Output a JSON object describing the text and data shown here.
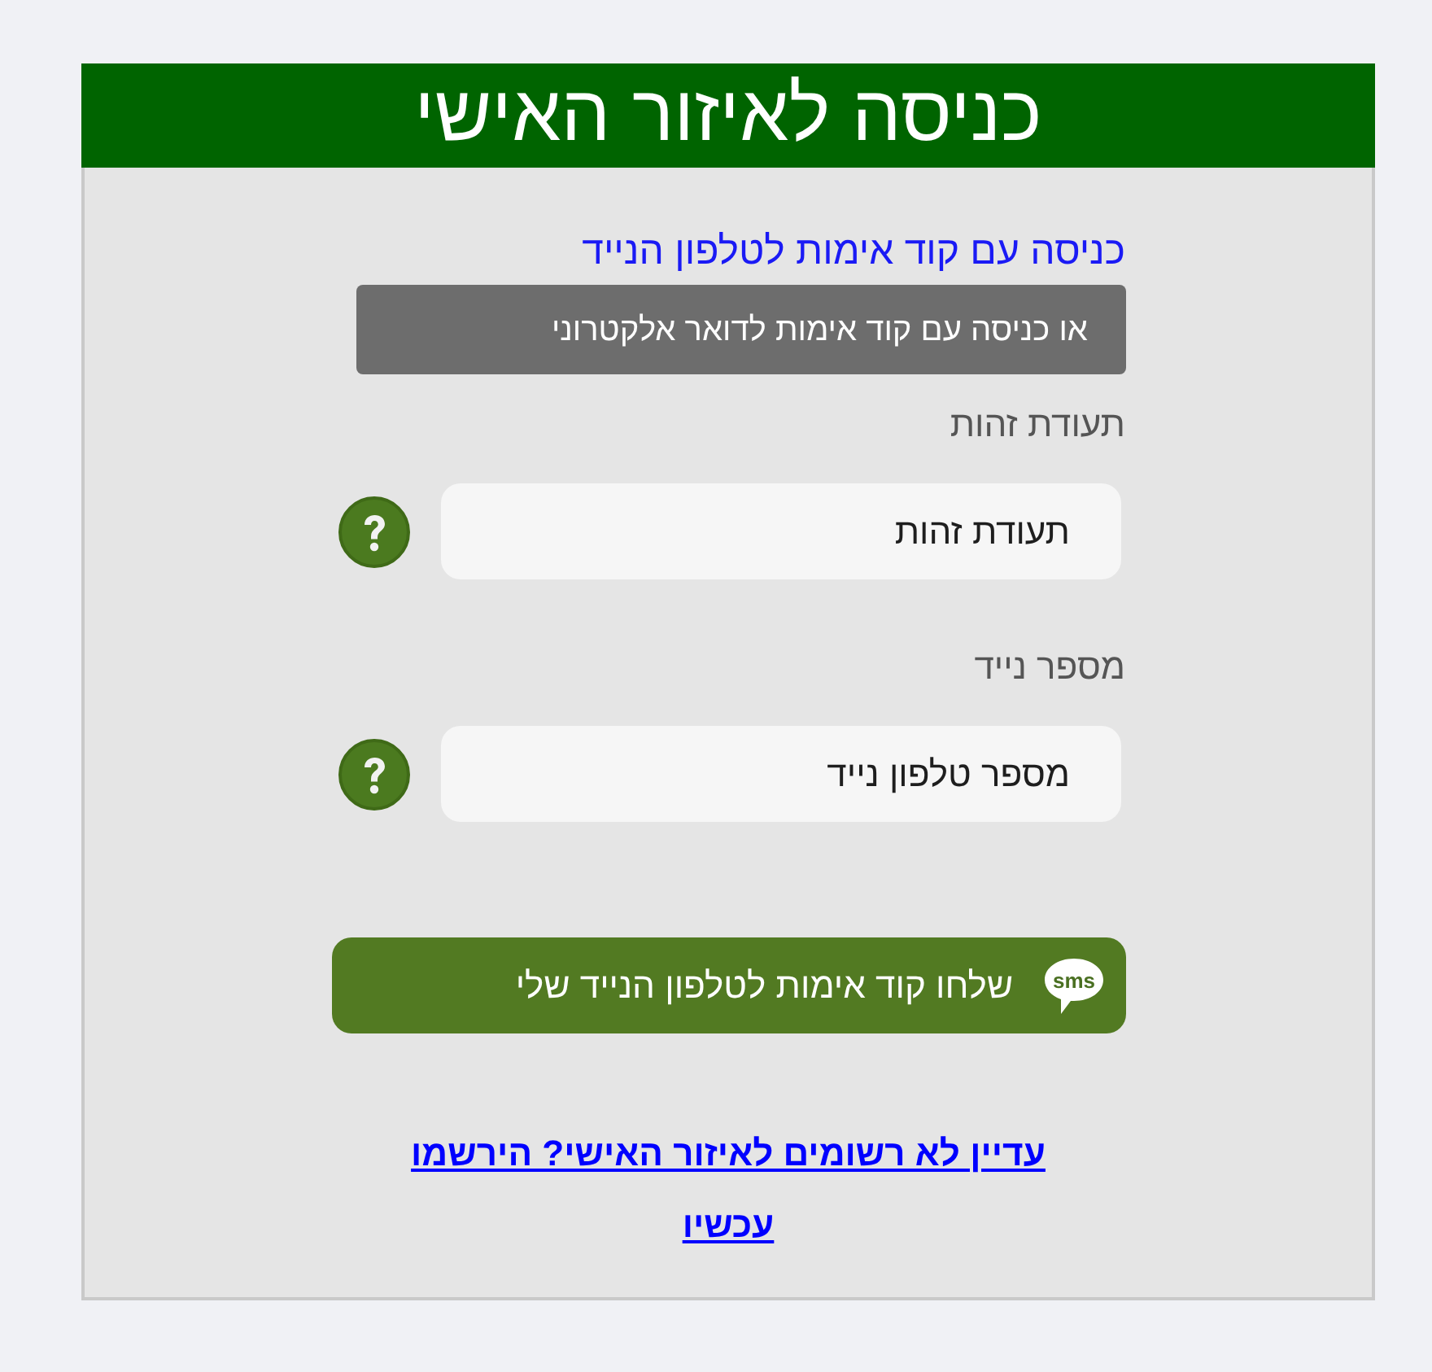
{
  "header": {
    "title": "כניסה לאיזור האישי"
  },
  "login_method": "כניסה עם קוד אימות לטלפון הנייד",
  "switch_method_button": "או כניסה עם קוד אימות לדואר אלקטרוני",
  "fields": [
    {
      "label": "תעודת זהות",
      "placeholder": "תעודת זהות"
    },
    {
      "label": "מספר נייד",
      "placeholder": "מספר טלפון נייד"
    }
  ],
  "send_button": {
    "icon_text": "sms",
    "label": "שלחו קוד אימות לטלפון הנייד שלי"
  },
  "register_link": "עדיין לא רשומים לאיזור האישי? הירשמו עכשיו"
}
